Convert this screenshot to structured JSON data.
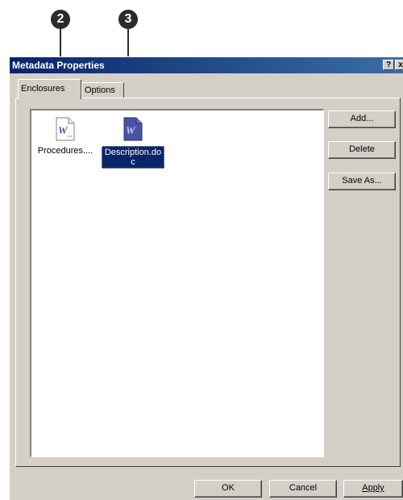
{
  "callouts": {
    "first": "2",
    "second": "3"
  },
  "window": {
    "title": "Metadata Properties",
    "help_button": "?",
    "close_button": "x"
  },
  "tabs": [
    {
      "label": "Enclosures",
      "active": true
    },
    {
      "label": "Options",
      "active": false
    }
  ],
  "files": [
    {
      "name": "Procedures....",
      "icon": "word-document-icon",
      "selected": false
    },
    {
      "name_line1": "Description.do",
      "name_line2": "c",
      "icon": "word-document-icon",
      "selected": true
    }
  ],
  "side_buttons": {
    "add": "Add...",
    "delete": "Delete",
    "save_as": "Save As..."
  },
  "footer_buttons": {
    "ok": "OK",
    "cancel": "Cancel",
    "apply": "Apply"
  },
  "colors": {
    "titlebar_start": "#0a246a",
    "titlebar_end": "#3a6ea5",
    "selection": "#0a246a",
    "dialog_face": "#d4d0c8"
  }
}
